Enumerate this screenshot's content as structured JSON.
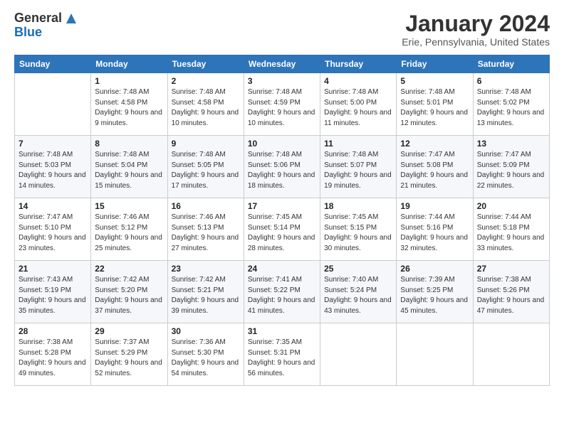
{
  "header": {
    "logo_general": "General",
    "logo_blue": "Blue",
    "month_title": "January 2024",
    "location": "Erie, Pennsylvania, United States"
  },
  "days_of_week": [
    "Sunday",
    "Monday",
    "Tuesday",
    "Wednesday",
    "Thursday",
    "Friday",
    "Saturday"
  ],
  "weeks": [
    [
      {
        "day": "",
        "sunrise": "",
        "sunset": "",
        "daylight": ""
      },
      {
        "day": "1",
        "sunrise": "Sunrise: 7:48 AM",
        "sunset": "Sunset: 4:58 PM",
        "daylight": "Daylight: 9 hours and 9 minutes."
      },
      {
        "day": "2",
        "sunrise": "Sunrise: 7:48 AM",
        "sunset": "Sunset: 4:58 PM",
        "daylight": "Daylight: 9 hours and 10 minutes."
      },
      {
        "day": "3",
        "sunrise": "Sunrise: 7:48 AM",
        "sunset": "Sunset: 4:59 PM",
        "daylight": "Daylight: 9 hours and 10 minutes."
      },
      {
        "day": "4",
        "sunrise": "Sunrise: 7:48 AM",
        "sunset": "Sunset: 5:00 PM",
        "daylight": "Daylight: 9 hours and 11 minutes."
      },
      {
        "day": "5",
        "sunrise": "Sunrise: 7:48 AM",
        "sunset": "Sunset: 5:01 PM",
        "daylight": "Daylight: 9 hours and 12 minutes."
      },
      {
        "day": "6",
        "sunrise": "Sunrise: 7:48 AM",
        "sunset": "Sunset: 5:02 PM",
        "daylight": "Daylight: 9 hours and 13 minutes."
      }
    ],
    [
      {
        "day": "7",
        "sunrise": "Sunrise: 7:48 AM",
        "sunset": "Sunset: 5:03 PM",
        "daylight": "Daylight: 9 hours and 14 minutes."
      },
      {
        "day": "8",
        "sunrise": "Sunrise: 7:48 AM",
        "sunset": "Sunset: 5:04 PM",
        "daylight": "Daylight: 9 hours and 15 minutes."
      },
      {
        "day": "9",
        "sunrise": "Sunrise: 7:48 AM",
        "sunset": "Sunset: 5:05 PM",
        "daylight": "Daylight: 9 hours and 17 minutes."
      },
      {
        "day": "10",
        "sunrise": "Sunrise: 7:48 AM",
        "sunset": "Sunset: 5:06 PM",
        "daylight": "Daylight: 9 hours and 18 minutes."
      },
      {
        "day": "11",
        "sunrise": "Sunrise: 7:48 AM",
        "sunset": "Sunset: 5:07 PM",
        "daylight": "Daylight: 9 hours and 19 minutes."
      },
      {
        "day": "12",
        "sunrise": "Sunrise: 7:47 AM",
        "sunset": "Sunset: 5:08 PM",
        "daylight": "Daylight: 9 hours and 21 minutes."
      },
      {
        "day": "13",
        "sunrise": "Sunrise: 7:47 AM",
        "sunset": "Sunset: 5:09 PM",
        "daylight": "Daylight: 9 hours and 22 minutes."
      }
    ],
    [
      {
        "day": "14",
        "sunrise": "Sunrise: 7:47 AM",
        "sunset": "Sunset: 5:10 PM",
        "daylight": "Daylight: 9 hours and 23 minutes."
      },
      {
        "day": "15",
        "sunrise": "Sunrise: 7:46 AM",
        "sunset": "Sunset: 5:12 PM",
        "daylight": "Daylight: 9 hours and 25 minutes."
      },
      {
        "day": "16",
        "sunrise": "Sunrise: 7:46 AM",
        "sunset": "Sunset: 5:13 PM",
        "daylight": "Daylight: 9 hours and 27 minutes."
      },
      {
        "day": "17",
        "sunrise": "Sunrise: 7:45 AM",
        "sunset": "Sunset: 5:14 PM",
        "daylight": "Daylight: 9 hours and 28 minutes."
      },
      {
        "day": "18",
        "sunrise": "Sunrise: 7:45 AM",
        "sunset": "Sunset: 5:15 PM",
        "daylight": "Daylight: 9 hours and 30 minutes."
      },
      {
        "day": "19",
        "sunrise": "Sunrise: 7:44 AM",
        "sunset": "Sunset: 5:16 PM",
        "daylight": "Daylight: 9 hours and 32 minutes."
      },
      {
        "day": "20",
        "sunrise": "Sunrise: 7:44 AM",
        "sunset": "Sunset: 5:18 PM",
        "daylight": "Daylight: 9 hours and 33 minutes."
      }
    ],
    [
      {
        "day": "21",
        "sunrise": "Sunrise: 7:43 AM",
        "sunset": "Sunset: 5:19 PM",
        "daylight": "Daylight: 9 hours and 35 minutes."
      },
      {
        "day": "22",
        "sunrise": "Sunrise: 7:42 AM",
        "sunset": "Sunset: 5:20 PM",
        "daylight": "Daylight: 9 hours and 37 minutes."
      },
      {
        "day": "23",
        "sunrise": "Sunrise: 7:42 AM",
        "sunset": "Sunset: 5:21 PM",
        "daylight": "Daylight: 9 hours and 39 minutes."
      },
      {
        "day": "24",
        "sunrise": "Sunrise: 7:41 AM",
        "sunset": "Sunset: 5:22 PM",
        "daylight": "Daylight: 9 hours and 41 minutes."
      },
      {
        "day": "25",
        "sunrise": "Sunrise: 7:40 AM",
        "sunset": "Sunset: 5:24 PM",
        "daylight": "Daylight: 9 hours and 43 minutes."
      },
      {
        "day": "26",
        "sunrise": "Sunrise: 7:39 AM",
        "sunset": "Sunset: 5:25 PM",
        "daylight": "Daylight: 9 hours and 45 minutes."
      },
      {
        "day": "27",
        "sunrise": "Sunrise: 7:38 AM",
        "sunset": "Sunset: 5:26 PM",
        "daylight": "Daylight: 9 hours and 47 minutes."
      }
    ],
    [
      {
        "day": "28",
        "sunrise": "Sunrise: 7:38 AM",
        "sunset": "Sunset: 5:28 PM",
        "daylight": "Daylight: 9 hours and 49 minutes."
      },
      {
        "day": "29",
        "sunrise": "Sunrise: 7:37 AM",
        "sunset": "Sunset: 5:29 PM",
        "daylight": "Daylight: 9 hours and 52 minutes."
      },
      {
        "day": "30",
        "sunrise": "Sunrise: 7:36 AM",
        "sunset": "Sunset: 5:30 PM",
        "daylight": "Daylight: 9 hours and 54 minutes."
      },
      {
        "day": "31",
        "sunrise": "Sunrise: 7:35 AM",
        "sunset": "Sunset: 5:31 PM",
        "daylight": "Daylight: 9 hours and 56 minutes."
      },
      {
        "day": "",
        "sunrise": "",
        "sunset": "",
        "daylight": ""
      },
      {
        "day": "",
        "sunrise": "",
        "sunset": "",
        "daylight": ""
      },
      {
        "day": "",
        "sunrise": "",
        "sunset": "",
        "daylight": ""
      }
    ]
  ]
}
